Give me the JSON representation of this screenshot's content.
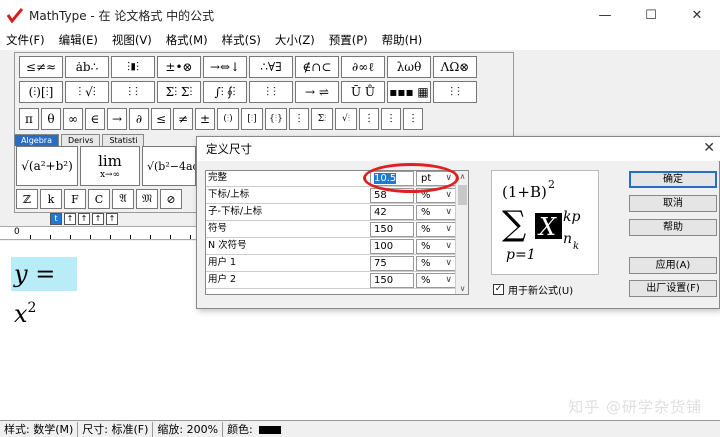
{
  "window": {
    "title": "MathType - 在 论文格式 中的公式",
    "minimize": "—",
    "maximize": "☐",
    "close": "✕"
  },
  "menu": [
    "文件(F)",
    "编辑(E)",
    "视图(V)",
    "格式(M)",
    "样式(S)",
    "大小(Z)",
    "预置(P)",
    "帮助(H)"
  ],
  "palette": {
    "row1": [
      "≤≠≈",
      "ȧb∴",
      "⫶∎⫶",
      "±•⊗",
      "→⇔↓",
      "∴∀∃",
      "∉∩⊂",
      "∂∞ℓ",
      "λωθ",
      "ΛΩ⊗"
    ],
    "row2": [
      "(⫶)[⫶]",
      "⫶ √⫶",
      "⫶ ⫶",
      "Σ⫶ Σ⫶",
      "∫⫶ ∮⫶",
      "⫶ ⫶",
      "→ ⇌",
      "Ū Ů",
      "▪▪▪ ▦",
      "⫶ ⫶"
    ],
    "row3": [
      "π",
      "θ",
      "∞",
      "∈",
      "→",
      "∂",
      "≤",
      "≠",
      "±",
      "(⫶)",
      "[⫶]",
      "{⫶}",
      "⫶",
      "Σ⫶",
      "√⫶",
      "⫶",
      "⫶",
      "⫶"
    ],
    "tabs": [
      "Algebra",
      "Derivs",
      "Statisti"
    ],
    "big1": "√(a²+b²)",
    "big2_top": "lim",
    "big2_bot": "x→∞",
    "big3": "√(b²−4ac)",
    "row4": [
      "ℤ",
      "k",
      "F",
      "C",
      "𝔄",
      "𝔐",
      "⊘"
    ],
    "size_buttons": [
      "t",
      "↑",
      "↑",
      "↑",
      "↑"
    ]
  },
  "ruler": {
    "zero": "0"
  },
  "editor": {
    "formula_lhs": "y",
    "formula_eq": " = ",
    "formula_base": "x",
    "formula_exp": "2"
  },
  "status": {
    "style": "样式: 数学(M)",
    "size": "尺寸: 标准(F)",
    "zoom": "缩放: 200%",
    "color": "颜色:"
  },
  "watermark": "知乎 @研学杂货铺",
  "dialog": {
    "title": "定义尺寸",
    "rows": [
      {
        "label": "完整",
        "value": "10.5",
        "unit": "pt"
      },
      {
        "label": "下标/上标",
        "value": "58",
        "unit": "%"
      },
      {
        "label": "子-下标/上标",
        "value": "42",
        "unit": "%"
      },
      {
        "label": "符号",
        "value": "150",
        "unit": "%"
      },
      {
        "label": "N 次符号",
        "value": "100",
        "unit": "%"
      },
      {
        "label": "用户 1",
        "value": "75",
        "unit": "%"
      },
      {
        "label": "用户 2",
        "value": "150",
        "unit": "%"
      }
    ],
    "checkbox_label": "用于新公式(U)",
    "buttons": {
      "ok": "确定",
      "cancel": "取消",
      "help": "帮助",
      "apply": "应用(A)",
      "factory": "出厂设置(F)"
    },
    "preview": {
      "top": "(1+B)",
      "top_exp": "2",
      "sigma": "∑",
      "x": "X",
      "sup": "kp",
      "sub": "n",
      "subsub": "k",
      "below": "p=1"
    }
  }
}
